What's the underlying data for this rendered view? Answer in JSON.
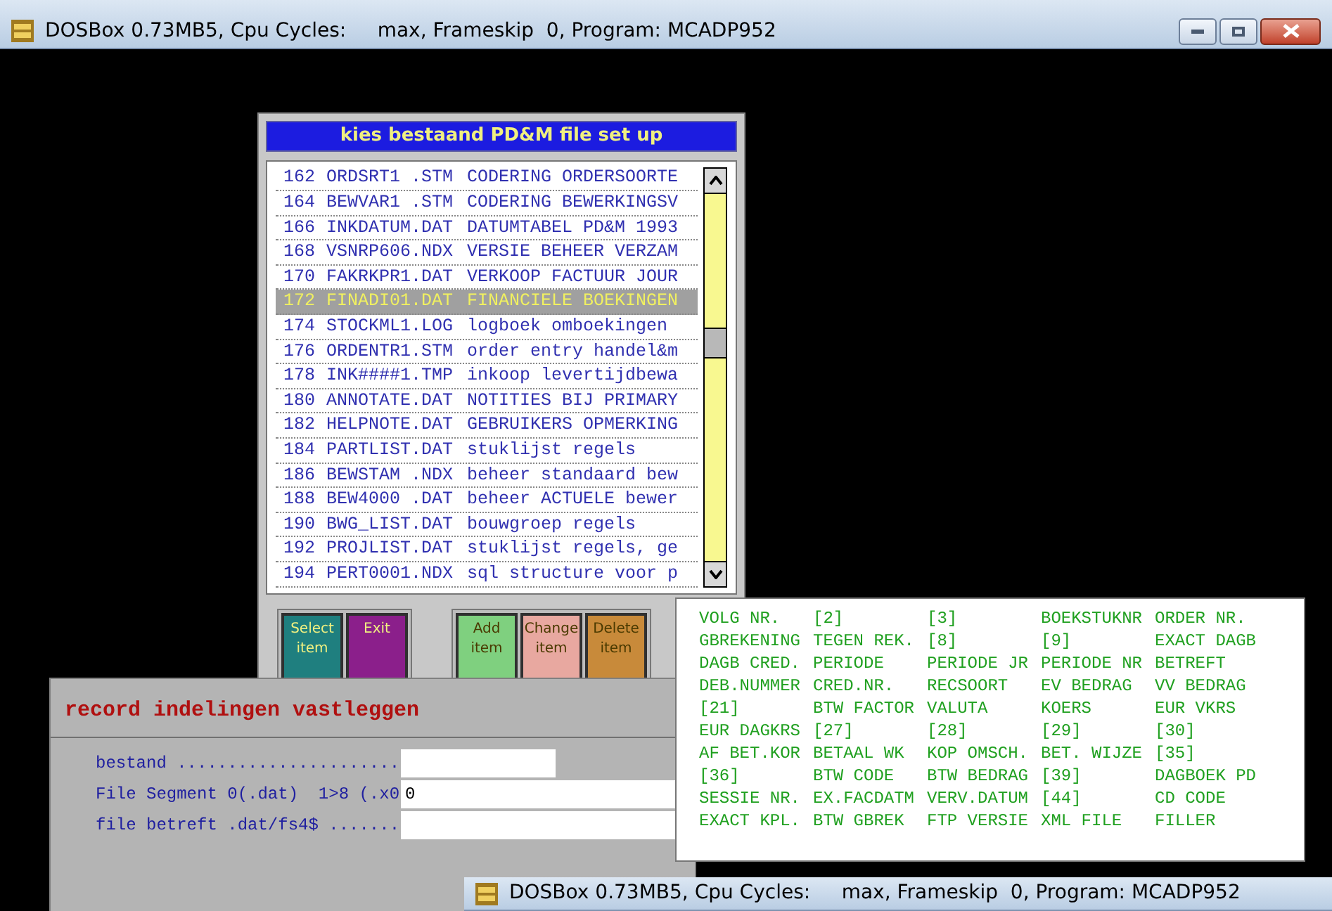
{
  "window": {
    "title": "DOSBox 0.73MB5, Cpu Cycles:     max, Frameskip  0, Program: MCADP952"
  },
  "file_dialog": {
    "title": "kies bestaand PD&M file set up",
    "rows": [
      {
        "number": "162",
        "file": "ORDSRT1 .STM",
        "description": "CODERING ORDERSOORTE",
        "selected": false
      },
      {
        "number": "164",
        "file": "BEWVAR1 .STM",
        "description": "CODERING BEWERKINGSV",
        "selected": false
      },
      {
        "number": "166",
        "file": "INKDATUM.DAT",
        "description": "DATUMTABEL PD&M 1993",
        "selected": false
      },
      {
        "number": "168",
        "file": "VSNRP606.NDX",
        "description": "VERSIE BEHEER VERZAM",
        "selected": false
      },
      {
        "number": "170",
        "file": "FAKRKPR1.DAT",
        "description": "VERKOOP FACTUUR JOUR",
        "selected": false
      },
      {
        "number": "172",
        "file": "FINADI01.DAT",
        "description": "FINANCIELE BOEKINGEN",
        "selected": true
      },
      {
        "number": "174",
        "file": "STOCKML1.LOG",
        "description": "logboek omboekingen",
        "selected": false
      },
      {
        "number": "176",
        "file": "ORDENTR1.STM",
        "description": "order entry handel&m",
        "selected": false
      },
      {
        "number": "178",
        "file": "INK####1.TMP",
        "description": "inkoop levertijdbewa",
        "selected": false
      },
      {
        "number": "180",
        "file": "ANNOTATE.DAT",
        "description": "NOTITIES BIJ PRIMARY",
        "selected": false
      },
      {
        "number": "182",
        "file": "HELPNOTE.DAT",
        "description": "GEBRUIKERS OPMERKING",
        "selected": false
      },
      {
        "number": "184",
        "file": "PARTLIST.DAT",
        "description": "stuklijst regels",
        "selected": false
      },
      {
        "number": "186",
        "file": "BEWSTAM .NDX",
        "description": "beheer standaard bew",
        "selected": false
      },
      {
        "number": "188",
        "file": "BEW4000 .DAT",
        "description": "beheer ACTUELE bewer",
        "selected": false
      },
      {
        "number": "190",
        "file": "BWG_LIST.DAT",
        "description": "bouwgroep regels",
        "selected": false
      },
      {
        "number": "192",
        "file": "PROJLIST.DAT",
        "description": "stuklijst regels, ge",
        "selected": false
      },
      {
        "number": "194",
        "file": "PERT0001.NDX",
        "description": "sql structure voor p",
        "selected": false
      }
    ],
    "buttons": [
      {
        "label": "Select item",
        "color": "#1f7f7f",
        "disabled": false
      },
      {
        "label": "Exit",
        "color": "#8b1f8b",
        "disabled": false
      },
      {
        "label": "Add item",
        "color": "#7fd07f",
        "disabled": true
      },
      {
        "label": "Change item",
        "color": "#e8a8a0",
        "disabled": true
      },
      {
        "label": "Delete item",
        "color": "#c88a3a",
        "disabled": true
      }
    ]
  },
  "field_names": [
    [
      "VOLG NR.",
      "[2]",
      "[3]",
      "BOEKSTUKNR",
      "ORDER NR."
    ],
    [
      "GBREKENING",
      "TEGEN REK.",
      "[8]",
      "[9]",
      "EXACT DAGB"
    ],
    [
      "DAGB CRED.",
      "PERIODE",
      "PERIODE JR",
      "PERIODE NR",
      "BETREFT"
    ],
    [
      "DEB.NUMMER",
      "CRED.NR.",
      "RECSOORT",
      "EV BEDRAG",
      "VV BEDRAG"
    ],
    [
      "[21]",
      "BTW FACTOR",
      "VALUTA",
      "KOERS",
      "EUR VKRS"
    ],
    [
      "EUR DAGKRS",
      "[27]",
      "[28]",
      "[29]",
      "[30]"
    ],
    [
      "AF BET.KOR",
      "BETAAL WK",
      "KOP OMSCH.",
      "BET. WIJZE",
      "[35]"
    ],
    [
      "[36]",
      "BTW CODE",
      "BTW BEDRAG",
      "[39]",
      "DAGBOEK PD"
    ],
    [
      "SESSIE NR.",
      "EX.FACDATM",
      "VERV.DATUM",
      "[44]",
      "CD CODE"
    ],
    [
      "EXACT KPL.",
      "BTW GBREK",
      "FTP VERSIE",
      "XML FILE",
      "FILLER"
    ]
  ],
  "record_panel": {
    "title": "record indelingen vastleggen",
    "fields": [
      {
        "label": "bestand ......................",
        "full_width": false
      },
      {
        "label": "File Segment 0(.dat)  1>8 (.x0",
        "value": "0",
        "full_width": true
      },
      {
        "label": "file betreft .dat/fs4$ .......",
        "full_width": true
      }
    ]
  },
  "second_window": {
    "title": "DOSBox 0.73MB5, Cpu Cycles:     max, Frameskip  0, Program: MCADP952"
  }
}
